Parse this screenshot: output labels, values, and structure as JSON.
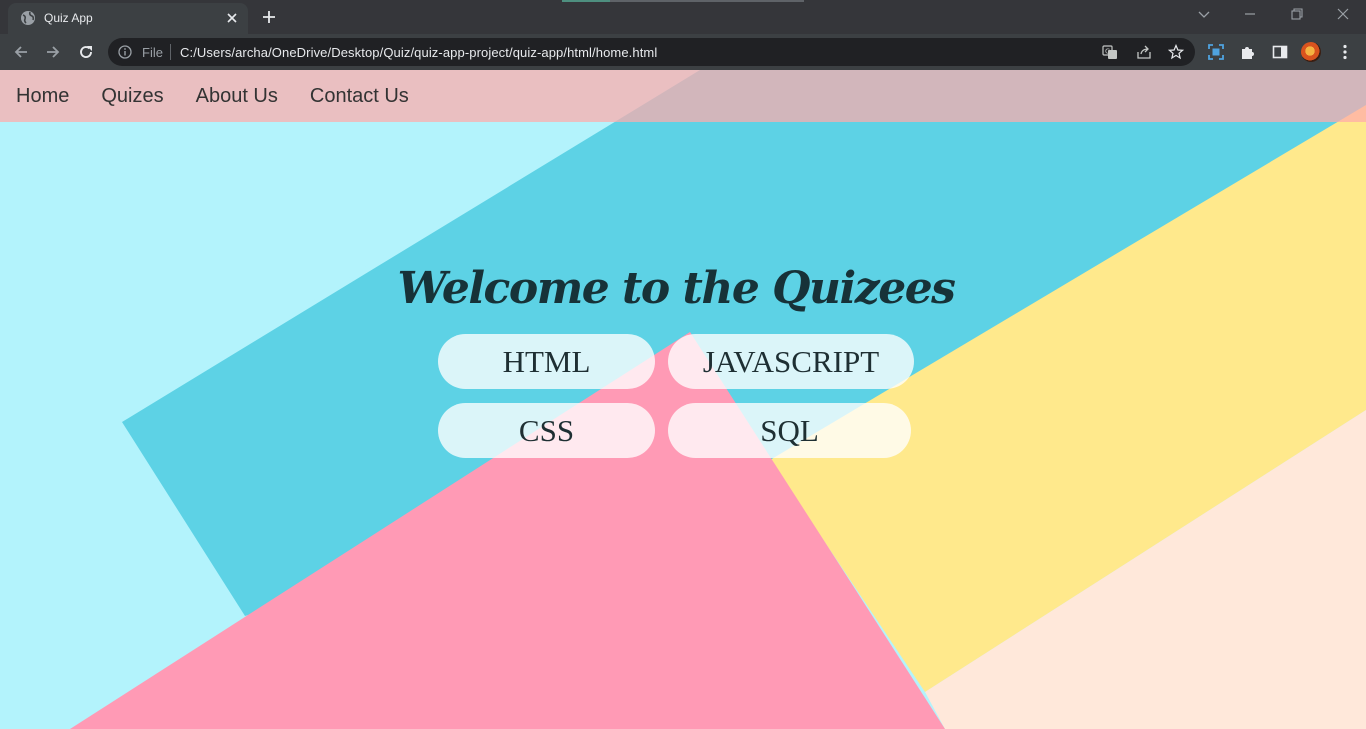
{
  "browser": {
    "tab_title": "Quiz App",
    "file_label": "File",
    "url": "C:/Users/archa/OneDrive/Desktop/Quiz/quiz-app-project/quiz-app/html/home.html"
  },
  "icons": {
    "favicon": "globe-icon",
    "tab_close": "close-icon",
    "new_tab": "plus-icon",
    "back": "arrow-left-icon",
    "forward": "arrow-right-icon",
    "reload": "reload-icon",
    "site_info": "info-icon",
    "translate": "translate-icon",
    "share": "share-icon",
    "bookmark": "star-icon",
    "screenshot": "screen-capture-icon",
    "extensions": "puzzle-icon",
    "side_panel": "side-panel-icon",
    "menu": "kebab-menu-icon"
  },
  "nav": {
    "links": [
      "Home",
      "Quizes",
      "About Us",
      "Contact Us"
    ]
  },
  "hero": {
    "title": "Welcome to the Quizees"
  },
  "quizzes": [
    "HTML",
    "JAVASCRIPT",
    "CSS",
    "SQL"
  ],
  "colors": {
    "background_light_cyan": "#b3f3fc",
    "background_cyan": "#5dd2e5",
    "background_pink": "#ff9ab5",
    "background_yellow": "#ffe98c",
    "background_peach": "#ffe8da",
    "navbar": "#ffaaaa",
    "title_text": "#173238"
  }
}
